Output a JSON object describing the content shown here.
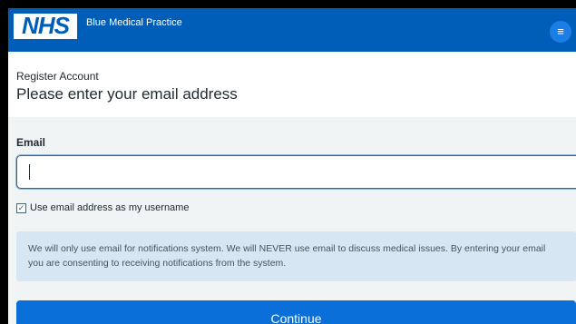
{
  "header": {
    "logo_text": "NHS",
    "practice_name": "Blue Medical Practice",
    "menu_icon": "hamburger-menu-icon",
    "brand_color": "#005eb8"
  },
  "page": {
    "breadcrumb": "Register Account",
    "heading": "Please enter your email address"
  },
  "form": {
    "email_label": "Email",
    "email_value": "",
    "use_as_username_label": "Use email address as my username",
    "use_as_username_checked": true,
    "info_text": "We will only use email for notifications system. We will NEVER use email to discuss medical issues. By entering your email you are consenting to receiving notifications from the system.",
    "continue_label": "Continue",
    "button_color": "#0a6fd8"
  }
}
